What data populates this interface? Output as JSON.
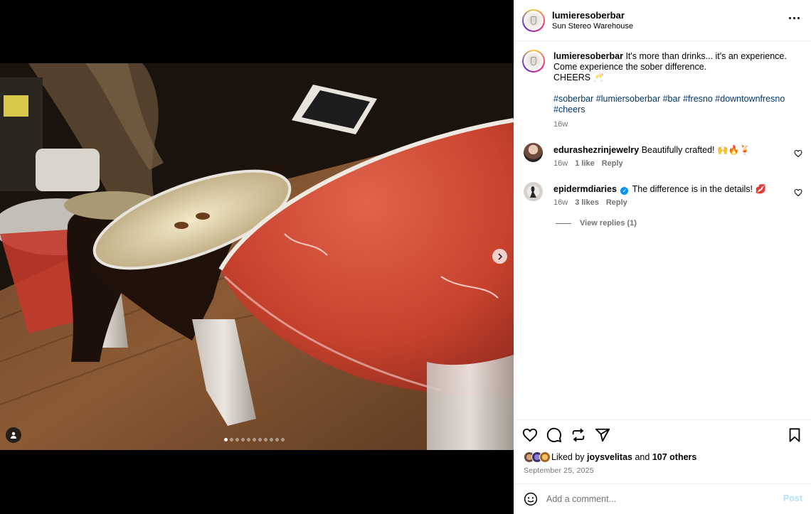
{
  "post": {
    "author": "lumieresoberbar",
    "location": "Sun Stereo Warehouse",
    "carousel": {
      "total": 11,
      "active": 1
    }
  },
  "caption": {
    "author": "lumieresoberbar",
    "line1": "It's more than drinks... it's an experience.",
    "line2": "Come experience the sober difference.",
    "line3": "CHEERS 🥂",
    "hashtags": [
      "#soberbar",
      "#lumiersoberbar",
      "#bar",
      "#fresno",
      "#downtownfresno",
      "#cheers"
    ],
    "time": "16w"
  },
  "comments": [
    {
      "author": "edurashezrinjewelry",
      "text": "Beautifully crafted! 🙌🔥🍹",
      "time": "16w",
      "likes": "1 like",
      "reply": "Reply",
      "verified": false
    },
    {
      "author": "epidermdiaries",
      "text": "The difference is in the details! 💋",
      "time": "16w",
      "likes": "3 likes",
      "reply": "Reply",
      "verified": true
    }
  ],
  "view_replies": "View replies (1)",
  "likes": {
    "prefix": "Liked by",
    "user": "joysvelitas",
    "conj": "and",
    "others": "107 others"
  },
  "date": "September 25, 2025",
  "add_comment": {
    "placeholder": "Add a comment...",
    "post_label": "Post"
  },
  "colors": {
    "link": "#00376b",
    "muted": "#737373",
    "post_disabled": "#b2dffc",
    "verified": "#0095f6"
  },
  "icons": [
    "heart-icon",
    "comment-icon",
    "repost-icon",
    "share-icon",
    "bookmark-icon",
    "emoji-icon",
    "more-icon",
    "chevron-right-icon",
    "user-tag-icon",
    "verified-icon"
  ]
}
